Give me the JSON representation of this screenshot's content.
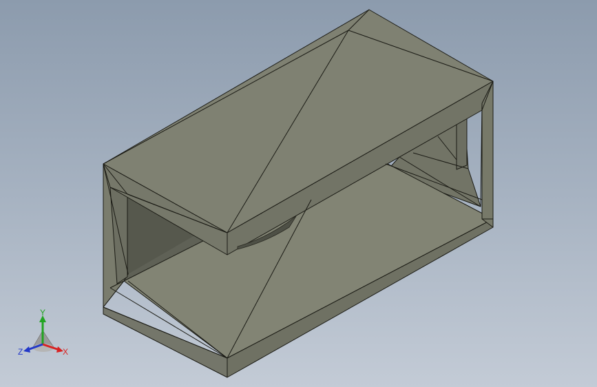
{
  "viewport": {
    "background_top": "#8c9bad",
    "background_bottom": "#c3cbd6"
  },
  "model": {
    "shape": "rectangular tube with open ends",
    "face_color": "#7c7e6e",
    "face_light": "#84867a",
    "face_dark": "#6f7163",
    "inner_color": "#5f6156",
    "edge_color": "#1a1a14"
  },
  "triad": {
    "x_label": "X",
    "y_label": "Y",
    "z_label": "Z",
    "x_color": "#d82222",
    "y_color": "#22a422",
    "z_color": "#2238c8"
  }
}
